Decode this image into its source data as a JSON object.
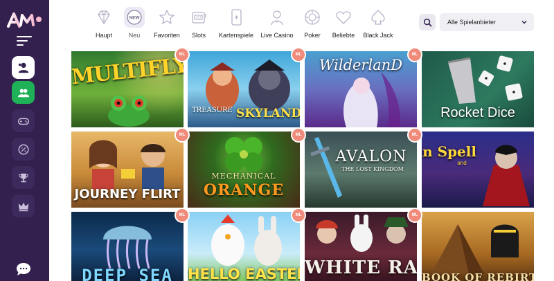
{
  "brand": {
    "accent": "#33204f",
    "green": "#1fb157",
    "badge": "#f08a7a"
  },
  "nav": {
    "items": [
      {
        "label": "Haupt",
        "icon": "diamond-icon"
      },
      {
        "label": "Neu",
        "icon": "new-icon"
      },
      {
        "label": "Favoriten",
        "icon": "star-icon"
      },
      {
        "label": "Slots",
        "icon": "slot-machine-icon"
      },
      {
        "label": "Kartenspiele",
        "icon": "card-icon"
      },
      {
        "label": "Live Casino",
        "icon": "dealer-icon"
      },
      {
        "label": "Poker",
        "icon": "poker-chip-icon"
      },
      {
        "label": "Beliebte",
        "icon": "heart-icon"
      },
      {
        "label": "Black Jack",
        "icon": "spade-icon"
      }
    ],
    "active_index": 1,
    "new_icon_text": "NEW",
    "provider_select": "Alle Spielanbieter"
  },
  "games": {
    "badge_text": "ML",
    "tiles": [
      {
        "title": "MULTIFLY!",
        "subtitle": ""
      },
      {
        "title": "SKYLAND",
        "subtitle": "TREASURE"
      },
      {
        "title": "WilderlanD",
        "subtitle": ""
      },
      {
        "title": "Rocket Dice",
        "subtitle": ""
      },
      {
        "title": "JOURNEY FLIRT",
        "subtitle": ""
      },
      {
        "title": "ORANGE",
        "subtitle": "MECHANICAL"
      },
      {
        "title": "AVALON",
        "subtitle": "THE LOST KINGDOM"
      },
      {
        "title": "Spin Spell",
        "subtitle": "and"
      },
      {
        "title": "DEEP SEA",
        "subtitle": ""
      },
      {
        "title": "HELLO EASTER",
        "subtitle": ""
      },
      {
        "title": "WHITE RABBIT",
        "subtitle": ""
      },
      {
        "title": "BOOK OF REBIRTH",
        "subtitle": ""
      }
    ]
  }
}
